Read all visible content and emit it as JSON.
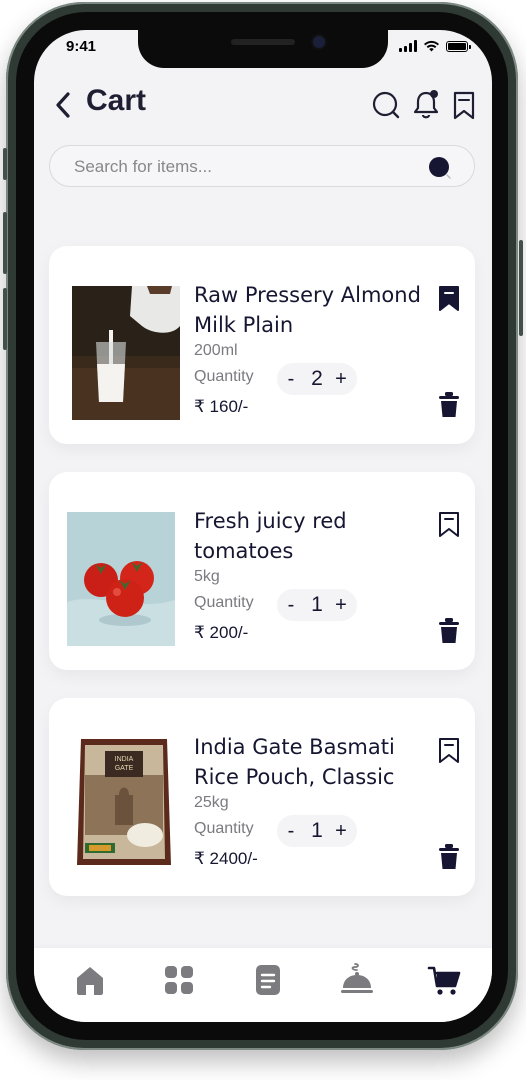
{
  "status_bar": {
    "time": "9:41"
  },
  "header": {
    "title": "Cart"
  },
  "search": {
    "placeholder": "Search for items..."
  },
  "cart": {
    "items": [
      {
        "name": "Raw Pressery Almond Milk Plain",
        "size": "200ml",
        "quantity_label": "Quantity",
        "quantity": "2",
        "price": "₹ 160/-",
        "bookmarked": true,
        "image": "milk-pouring-photo"
      },
      {
        "name": "Fresh juicy red tomatoes",
        "size": "5kg",
        "quantity_label": "Quantity",
        "quantity": "1",
        "price": "₹ 200/-",
        "bookmarked": false,
        "image": "tomatoes-photo"
      },
      {
        "name": "India Gate Basmati Rice Pouch, Classic",
        "size": "25kg",
        "quantity_label": "Quantity",
        "quantity": "1",
        "price": "₹ 2400/-",
        "bookmarked": false,
        "image": "rice-pouch-photo"
      }
    ],
    "minus_label": "-",
    "plus_label": "+"
  },
  "tabbar": {
    "tabs": [
      "home-icon",
      "categories-icon",
      "orders-icon",
      "dish-icon",
      "cart-icon"
    ],
    "active": "cart-icon"
  },
  "colors": {
    "primary": "#161632",
    "icon_inactive": "#7c7c80",
    "background": "#f3f3f6",
    "card": "#ffffff"
  }
}
